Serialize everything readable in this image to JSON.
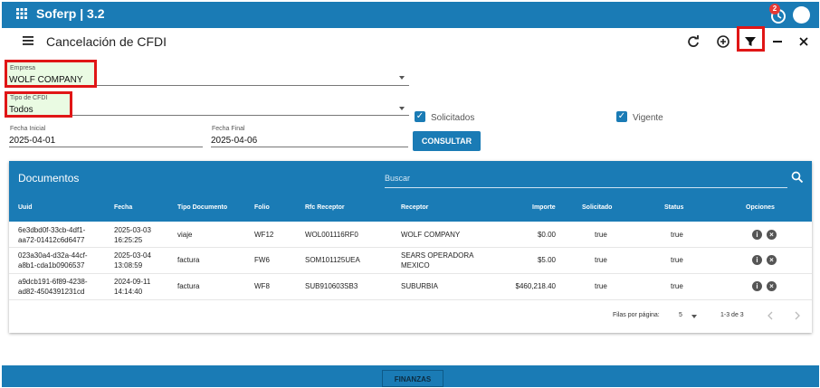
{
  "app": {
    "title": "Soferp | 3.2",
    "notification_count": "2"
  },
  "page": {
    "title": "Cancelación de CFDI"
  },
  "filters": {
    "empresa": {
      "label": "Empresa",
      "value": "WOLF COMPANY"
    },
    "tipo": {
      "label": "Tipo de CFDI",
      "value": "Todos"
    },
    "fecha_inicial": {
      "label": "Fecha Inicial",
      "value": "2025-04-01"
    },
    "fecha_final": {
      "label": "Fecha Final",
      "value": "2025-04-06"
    },
    "solicitados": {
      "label": "Solicitados",
      "checked": true
    },
    "vigente": {
      "label": "Vigente",
      "checked": true
    },
    "consultar_label": "CONSULTAR"
  },
  "table": {
    "title": "Documentos",
    "search_placeholder": "Buscar",
    "headers": {
      "uuid": "Uuid",
      "fecha": "Fecha",
      "tipo": "Tipo Documento",
      "folio": "Folio",
      "rfc": "Rfc Receptor",
      "receptor": "Receptor",
      "importe": "Importe",
      "solicitado": "Solicitado",
      "status": "Status",
      "opciones": "Opciones"
    },
    "rows": [
      {
        "uuid1": "6e3dbd0f-33cb-4df1-",
        "uuid2": "aa72-01412c6d6477",
        "fecha1": "2025-03-03",
        "fecha2": "16:25:25",
        "tipo": "viaje",
        "folio": "WF12",
        "rfc": "WOL001116RF0",
        "receptor1": "WOLF COMPANY",
        "receptor2": "",
        "importe": "$0.00",
        "solicitado": "true",
        "status": "true"
      },
      {
        "uuid1": "023a30a4-d32a-44cf-",
        "uuid2": "a8b1-cda1b0906537",
        "fecha1": "2025-03-04",
        "fecha2": "13:08:59",
        "tipo": "factura",
        "folio": "FW6",
        "rfc": "SOM101125UEA",
        "receptor1": "SEARS OPERADORA",
        "receptor2": "MEXICO",
        "importe": "$5.00",
        "solicitado": "true",
        "status": "true"
      },
      {
        "uuid1": "a9dcb191-6f89-4238-",
        "uuid2": "ad82-4504391231cd",
        "fecha1": "2024-09-11",
        "fecha2": "14:14:40",
        "tipo": "factura",
        "folio": "WF8",
        "rfc": "SUB910603SB3",
        "receptor1": "SUBURBIA",
        "receptor2": "",
        "importe": "$460,218.40",
        "solicitado": "true",
        "status": "true"
      }
    ],
    "pagination": {
      "label": "Filas por página:",
      "per_page": "5",
      "range": "1-3 de 3"
    }
  },
  "footer": {
    "button_label": "FINANZAS"
  },
  "icons": [
    "apps-icon",
    "history-icon",
    "refresh-icon",
    "add-circle-icon",
    "filter-icon",
    "minimize-icon",
    "close-icon",
    "search-icon",
    "info-icon",
    "cancel-icon",
    "chevron-left-icon",
    "chevron-right-icon"
  ],
  "colors": {
    "primary": "#1a7bb5",
    "highlight": "#e01616",
    "field_bg": "#eafbe3"
  }
}
